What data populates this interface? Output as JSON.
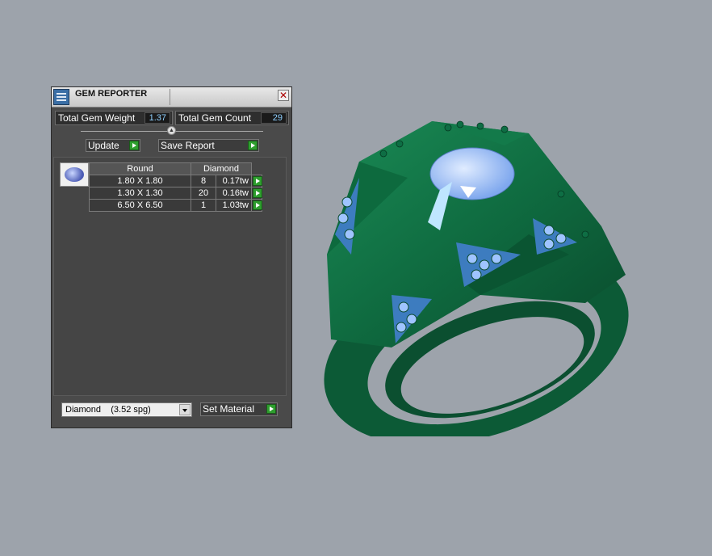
{
  "panel": {
    "title": "GEM REPORTER",
    "close_glyph": "✕",
    "total_weight_label": "Total Gem Weight",
    "total_weight_value": "1.37",
    "total_count_label": "Total Gem Count",
    "total_count_value": "29",
    "update_label": "Update",
    "save_report_label": "Save Report",
    "set_material_label": "Set Material"
  },
  "table": {
    "shape_header": "Round",
    "material_header": "Diamond",
    "rows": [
      {
        "size": "1.80 X 1.80",
        "count": "8",
        "weight": "0.17tw"
      },
      {
        "size": "1.30 X 1.30",
        "count": "20",
        "weight": "0.16tw"
      },
      {
        "size": "6.50 X 6.50",
        "count": "1",
        "weight": "1.03tw"
      }
    ]
  },
  "material": {
    "selected": "Diamond    (3.52 spg)"
  },
  "colors": {
    "metal": "#0f6b40",
    "gem": "#9fc4ff",
    "background": "#9da3ab",
    "accent_green": "#2e9e2e"
  },
  "icons": [
    "app-icon",
    "close-icon",
    "gem-thumbnail-icon",
    "go-arrow-icon",
    "chevron-down-icon",
    "slider-knob-icon"
  ]
}
